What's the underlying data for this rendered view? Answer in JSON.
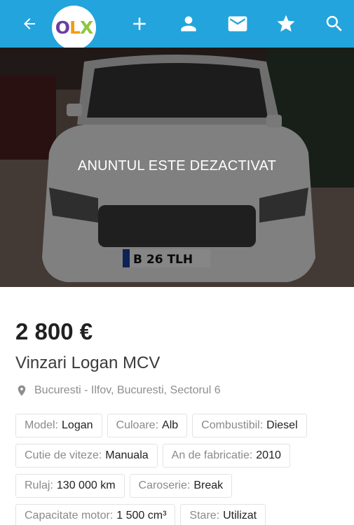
{
  "topbar": {
    "logo": {
      "o": "O",
      "l": "L",
      "x": "X"
    },
    "icons": [
      "back-arrow-icon",
      "olx-logo",
      "plus-icon",
      "user-icon",
      "mail-icon",
      "star-icon",
      "search-icon"
    ],
    "color": "#23a4dc"
  },
  "photo": {
    "overlay_text": "ANUNTUL ESTE DEZACTIVAT",
    "plate": "B 26 TLH"
  },
  "listing": {
    "price": "2 800 €",
    "title": "Vinzari Logan MCV",
    "location": "Bucuresti - Ilfov, Bucuresti, Sectorul 6"
  },
  "params": [
    [
      {
        "label": "Model:",
        "value": "Logan"
      },
      {
        "label": "Culoare:",
        "value": "Alb"
      },
      {
        "label": "Combustibil:",
        "value": "Diesel"
      }
    ],
    [
      {
        "label": "Cutie de viteze:",
        "value": "Manuala"
      },
      {
        "label": "An de fabricatie:",
        "value": "2010"
      }
    ],
    [
      {
        "label": "Rulaj:",
        "value": "130 000 km"
      },
      {
        "label": "Caroserie:",
        "value": "Break"
      }
    ],
    [
      {
        "label": "Capacitate motor:",
        "value": "1 500 cm³"
      },
      {
        "label": "Stare:",
        "value": "Utilizat"
      }
    ]
  ]
}
